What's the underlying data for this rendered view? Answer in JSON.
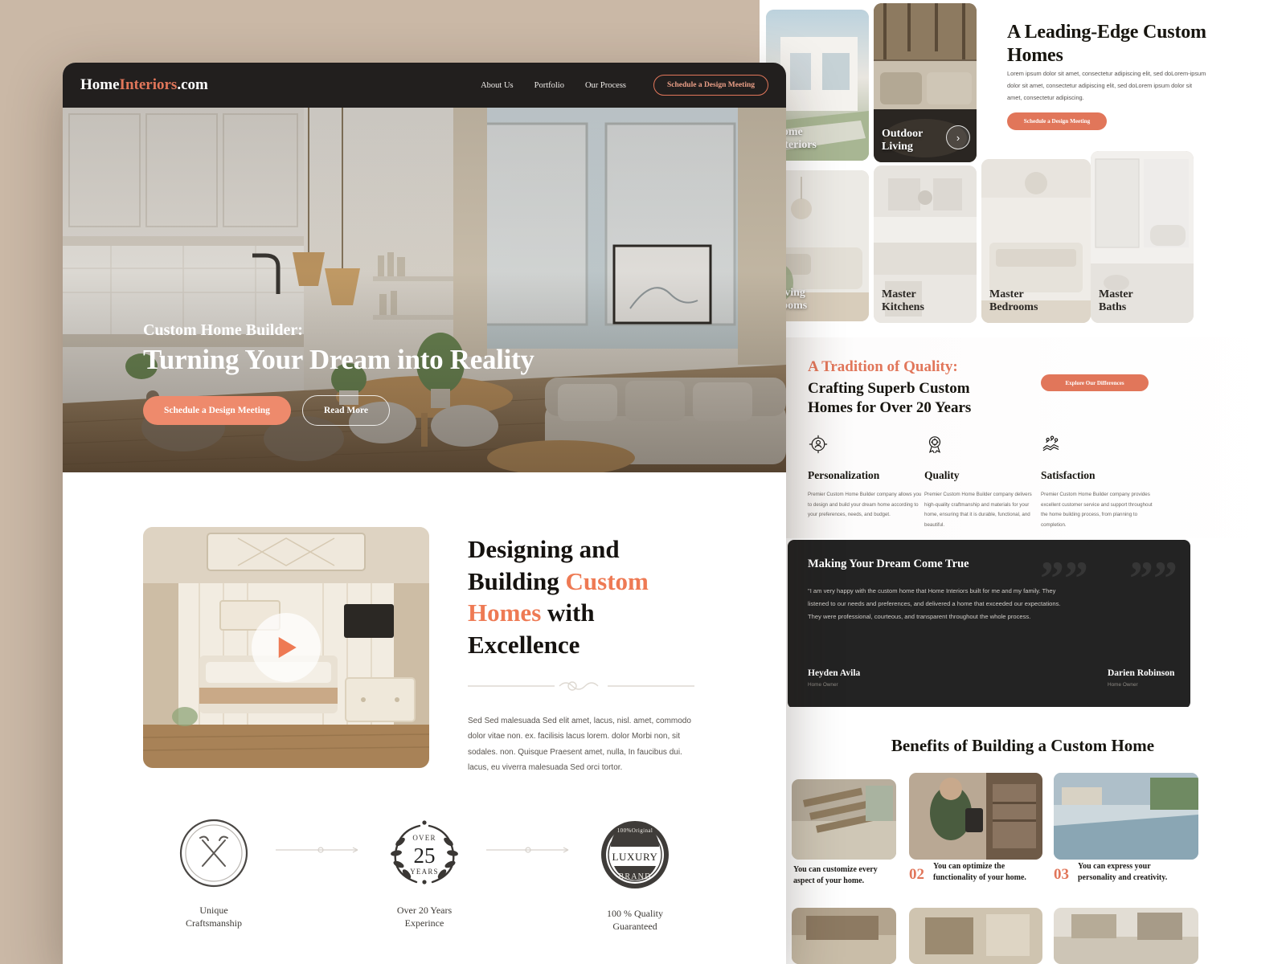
{
  "colors": {
    "page_background": "#cab8a6",
    "accent": "#e1765a",
    "accent_light": "#ee8a6c",
    "dark": "#221f1e",
    "card_dark": "#232323"
  },
  "left_page": {
    "navbar": {
      "logo_primary": "Home",
      "logo_accent": "Interiors",
      "logo_suffix": ".com",
      "links": [
        {
          "label": "About Us"
        },
        {
          "label": "Portfolio"
        },
        {
          "label": "Our Process"
        }
      ],
      "cta_label": "Schedule a Design Meeting"
    },
    "hero": {
      "eyebrow": "Custom Home Builder:",
      "title": "Turning Your Dream into Reality",
      "primary_button": "Schedule a Design Meeting",
      "secondary_button": "Read More",
      "image_alt": "modern-kitchen-living-room-interior"
    },
    "design_section": {
      "heading_part1": "Designing and Building ",
      "heading_accent1": "Custom Homes",
      "heading_part2": " with Excellence",
      "body": "Sed Sed malesuada Sed elit amet, lacus, nisl. amet, commodo dolor vitae non. ex. facilisis lacus lorem. dolor Morbi non, sit sodales. non. Quisque Praesent amet, nulla, In faucibus dui. lacus, eu viverra malesuada Sed orci tortor.",
      "video_alt": "luxury-bedroom-interior-video",
      "play_icon": "play-icon"
    },
    "badges": [
      {
        "icon": "craftsmanship-tools-badge-icon",
        "label_line1": "Unique",
        "label_line2": "Craftsmanship",
        "stamp_top": "",
        "stamp_value": "",
        "stamp_bottom": ""
      },
      {
        "icon": "laurel-wreath-years-badge-icon",
        "label_line1": "Over 20 Years",
        "label_line2": "Experince",
        "stamp_top": "OVER",
        "stamp_value": "25",
        "stamp_bottom": "YEARS"
      },
      {
        "icon": "luxury-brand-seal-badge-icon",
        "label_line1": "100 % Quality",
        "label_line2": "Guaranteed",
        "stamp_top": "100%Original",
        "stamp_value": "LUXURY",
        "stamp_bottom": "BRAND"
      }
    ]
  },
  "right_page": {
    "hero": {
      "title": "A Leading-Edge Custom Homes",
      "body": "Lorem ipsum dolor sit amet, consectetur adipiscing elit, sed doLorem-ipsum dolor sit amet, consectetur adipiscing elit, sed doLorem ipsum dolor sit amet, consectetur adipiscing.",
      "cta_label": "Schedule a Design Meeting"
    },
    "categories": [
      {
        "label_line1": "Home",
        "label_line2": "Interiors",
        "tone": "light"
      },
      {
        "label_line1": "Outdoor",
        "label_line2": "Living",
        "tone": "light",
        "arrow_icon": "chevron-right-icon"
      },
      {
        "label_line1": "Living",
        "label_line2": "Rooms",
        "tone": "dark"
      },
      {
        "label_line1": "Master",
        "label_line2": "Kitchens",
        "tone": "dark"
      },
      {
        "label_line1": "Master",
        "label_line2": "Bedrooms",
        "tone": "dark"
      },
      {
        "label_line1": "Master",
        "label_line2": "Baths",
        "tone": "dark"
      }
    ],
    "tradition": {
      "eyebrow": "A Tradition of Quality:",
      "heading": "Crafting Superb Custom Homes for Over 20 Years",
      "cta_label": "Explore Our Differences",
      "features": [
        {
          "icon": "personalization-user-target-icon",
          "title": "Personalization",
          "body": "Premier Custom Home Builder company allows you to design and build your dream home according to your preferences, needs, and budget."
        },
        {
          "icon": "quality-award-ribbon-icon",
          "title": "Quality",
          "body": "Premier Custom Home Builder company delivers high-quality craftmanship and materials for your home, ensuring that it is durable, functional, and beautiful."
        },
        {
          "icon": "satisfaction-handshake-stars-icon",
          "title": "Satisfaction",
          "body": "Premier Custom Home Builder company provides excellent customer service and support throughout the home building process, from planning to completion."
        }
      ]
    },
    "testimonials": {
      "quote_icon": "quotation-mark-icon",
      "primary": {
        "heading": "Making Your Dream Come True",
        "quote": "\"I am very happy with the custom home that Home Interiors built for me and my family. They listened to our needs and preferences, and delivered a home that exceeded our expectations. They were professional, courteous, and transparent throughout the whole process.",
        "name": "Heyden Avila",
        "role": "Home Owner"
      },
      "secondary": {
        "name": "Darien Robinson",
        "role": "Home Owner"
      }
    },
    "benefits": {
      "heading": "Benefits of Building a Custom Home",
      "items": [
        {
          "number": "",
          "caption_line1": "You can customize every",
          "caption_line2": "aspect of your home.",
          "image_alt": "flooring-samples-on-desk"
        },
        {
          "number": "02",
          "caption_line1": "You can optimize the",
          "caption_line2": "functionality of your home.",
          "image_alt": "woman-designing-interior"
        },
        {
          "number": "03",
          "caption_line1": "You can express your",
          "caption_line2": "personality and creativity.",
          "image_alt": "outdoor-pool-patio"
        }
      ]
    }
  }
}
